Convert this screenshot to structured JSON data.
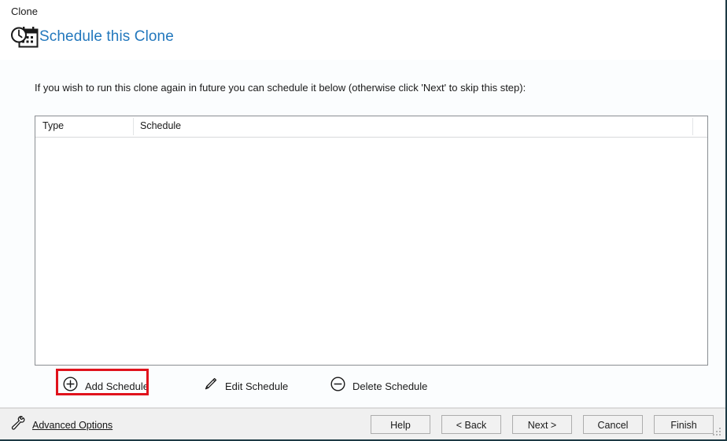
{
  "window": {
    "caption": "Clone",
    "title": "Schedule this Clone",
    "title_color": "#2378bd",
    "header_icon": "schedule-clock-calendar-icon"
  },
  "content": {
    "intro_text": "If you wish to run this clone again in future you can schedule it below (otherwise click 'Next' to skip this step):",
    "listview": {
      "columns": [
        {
          "label": "Type"
        },
        {
          "label": "Schedule"
        }
      ],
      "rows": []
    },
    "commands": [
      {
        "label": "Add Schedule",
        "icon": "plus-circle-icon",
        "highlighted": true
      },
      {
        "label": "Edit Schedule",
        "icon": "pencil-icon",
        "highlighted": false
      },
      {
        "label": "Delete Schedule",
        "icon": "minus-circle-icon",
        "highlighted": false
      }
    ],
    "highlight_color": "#e0121c"
  },
  "footer": {
    "advanced_options": {
      "label": "Advanced Options",
      "icon": "wrench-icon"
    },
    "buttons": [
      {
        "label": "Help"
      },
      {
        "label": "< Back"
      },
      {
        "label": "Next >"
      },
      {
        "label": "Cancel"
      },
      {
        "label": "Finish"
      }
    ]
  }
}
